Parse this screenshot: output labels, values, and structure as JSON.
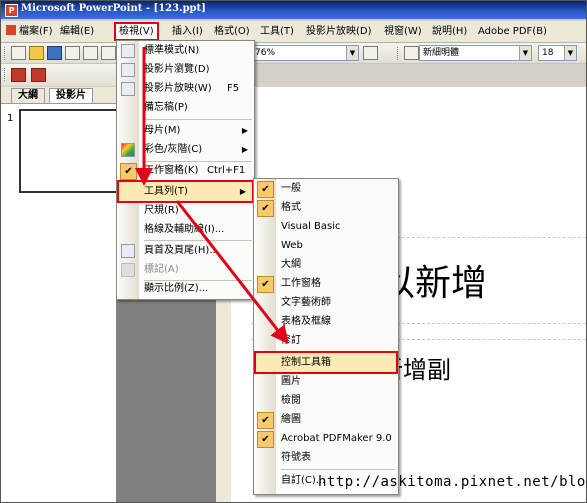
{
  "window": {
    "title": "Microsoft PowerPoint - [123.ppt]"
  },
  "menubar": {
    "items": [
      {
        "label": "檔案(F)"
      },
      {
        "label": "編輯(E)"
      },
      {
        "label": "檢視(V)"
      },
      {
        "label": "插入(I)"
      },
      {
        "label": "格式(O)"
      },
      {
        "label": "工具(T)"
      },
      {
        "label": "投影片放映(D)"
      },
      {
        "label": "視窗(W)"
      },
      {
        "label": "說明(H)"
      },
      {
        "label": "Adobe PDF(B)"
      }
    ]
  },
  "toolbar": {
    "zoom": "76%",
    "font_name": "新細明體",
    "font_size": "18"
  },
  "left_pane": {
    "tabs": [
      "大綱",
      "投影片"
    ],
    "slide_number": "1"
  },
  "view_menu": {
    "items": [
      {
        "label": "標準模式(N)",
        "shortcut": ""
      },
      {
        "label": "投影片瀏覽(D)",
        "shortcut": ""
      },
      {
        "label": "投影片放映(W)",
        "shortcut": "F5"
      },
      {
        "label": "備忘稿(P)",
        "shortcut": ""
      },
      {
        "label": "母片(M)",
        "shortcut": ""
      },
      {
        "label": "彩色/灰階(C)",
        "shortcut": ""
      },
      {
        "label": "工作窗格(K)",
        "shortcut": "Ctrl+F1"
      },
      {
        "label": "工具列(T)",
        "shortcut": ""
      },
      {
        "label": "尺規(R)",
        "shortcut": ""
      },
      {
        "label": "格線及輔助線(I)...",
        "shortcut": ""
      },
      {
        "label": "頁首及頁尾(H)...",
        "shortcut": ""
      },
      {
        "label": "標記(A)",
        "shortcut": ""
      },
      {
        "label": "顯示比例(Z)...",
        "shortcut": ""
      }
    ]
  },
  "toolbars_submenu": {
    "items": [
      {
        "label": "一般",
        "checked": true
      },
      {
        "label": "格式",
        "checked": true
      },
      {
        "label": "Visual Basic",
        "checked": false
      },
      {
        "label": "Web",
        "checked": false
      },
      {
        "label": "大綱",
        "checked": false
      },
      {
        "label": "工作窗格",
        "checked": true
      },
      {
        "label": "文字藝術師",
        "checked": false
      },
      {
        "label": "表格及框線",
        "checked": false
      },
      {
        "label": "修訂",
        "checked": false
      },
      {
        "label": "控制工具箱",
        "checked": false
      },
      {
        "label": "圖片",
        "checked": false
      },
      {
        "label": "檢閱",
        "checked": false
      },
      {
        "label": "繪圖",
        "checked": true
      },
      {
        "label": "Acrobat PDFMaker 9.0",
        "checked": true
      },
      {
        "label": "符號表",
        "checked": false
      },
      {
        "label": "自訂(C)...",
        "checked": false
      }
    ]
  },
  "slide": {
    "title_placeholder": "按一下以新增",
    "subtitle_placeholder": "按一下以新增副"
  },
  "watermark": "http://askitoma.pixnet.net/blog",
  "colors": {
    "highlight_border": "#e0001a",
    "checked_bg": "#f5c96c",
    "title_bar": "#0a246a"
  }
}
